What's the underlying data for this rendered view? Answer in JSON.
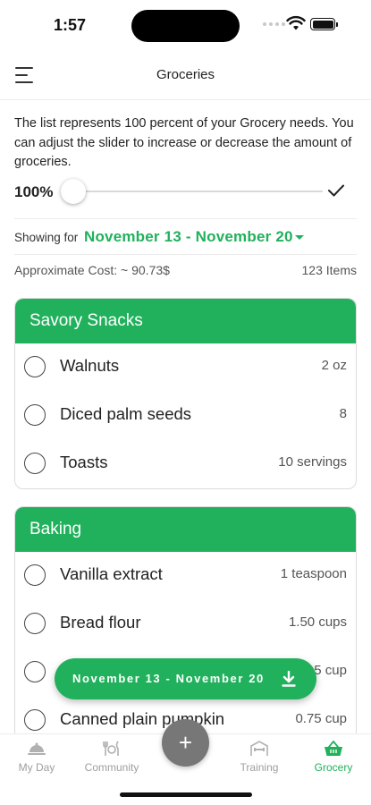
{
  "status_bar": {
    "time": "1:57"
  },
  "header": {
    "title": "Groceries"
  },
  "intro_text": "The list represents 100 percent of your Grocery needs. You can adjust the slider to increase or decrease the amount of groceries.",
  "slider": {
    "label": "100%",
    "value_percent": 100
  },
  "showing": {
    "label": "Showing for",
    "date_range": "November 13 - November 20"
  },
  "summary": {
    "cost": "Approximate Cost: ~ 90.73$",
    "items": "123 Items"
  },
  "categories": [
    {
      "name": "Savory Snacks",
      "items": [
        {
          "name": "Walnuts",
          "qty": "2 oz"
        },
        {
          "name": "Diced palm seeds",
          "qty": "8"
        },
        {
          "name": "Toasts",
          "qty": "10 servings"
        }
      ]
    },
    {
      "name": "Baking",
      "items": [
        {
          "name": "Vanilla extract",
          "qty": "1 teaspoon"
        },
        {
          "name": "Bread flour",
          "qty": "1.50 cups"
        },
        {
          "name": "",
          "qty": "5 cup"
        },
        {
          "name": "Canned plain pumpkin",
          "qty": "0.75 cup"
        }
      ]
    }
  ],
  "week_pill": {
    "label": "November 13 - November 20"
  },
  "nav": {
    "my_day": "My Day",
    "community": "Community",
    "add": "+",
    "training": "Training",
    "grocery": "Grocery"
  },
  "colors": {
    "accent": "#21b15c",
    "fab": "#777777"
  }
}
